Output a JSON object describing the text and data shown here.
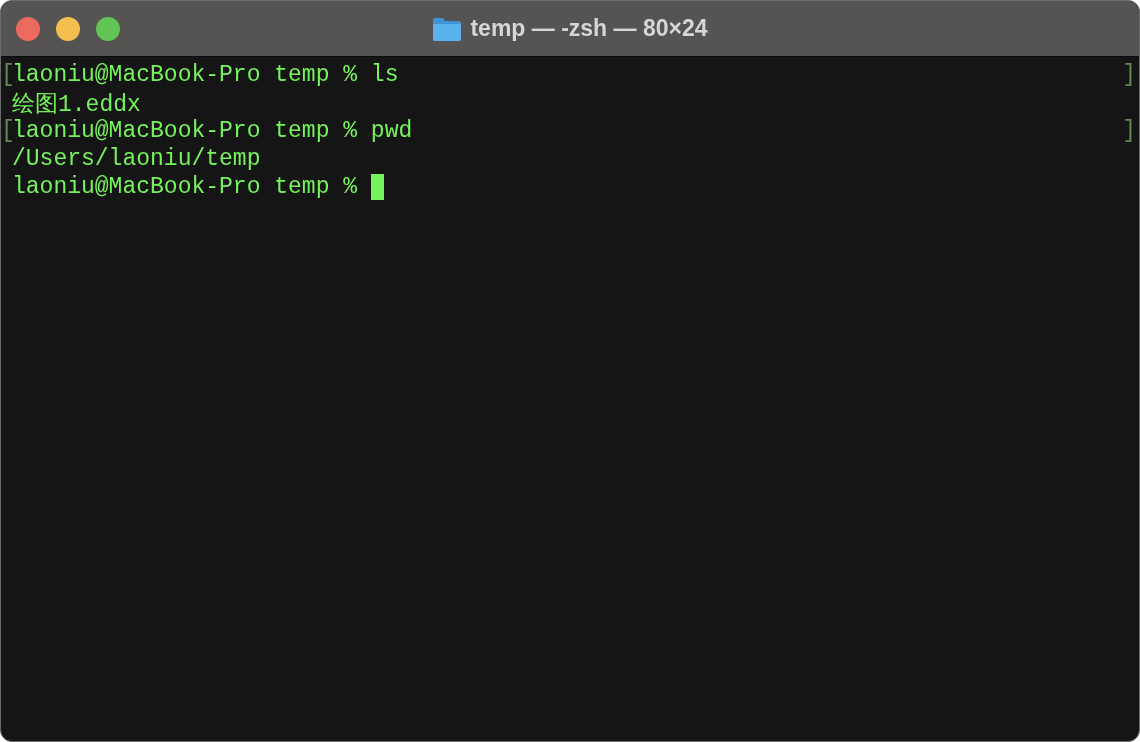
{
  "window": {
    "title": "temp — -zsh — 80×24"
  },
  "lines": [
    {
      "text": "laoniu@MacBook-Pro temp % ls",
      "mark_left": "[",
      "mark_right": "]",
      "cursor": false
    },
    {
      "text": "绘图1.eddx",
      "cursor": false
    },
    {
      "text": "laoniu@MacBook-Pro temp % pwd",
      "mark_left": "[",
      "mark_right": "]",
      "cursor": false
    },
    {
      "text": "/Users/laoniu/temp",
      "cursor": false
    },
    {
      "text": "laoniu@MacBook-Pro temp % ",
      "cursor": true
    }
  ]
}
